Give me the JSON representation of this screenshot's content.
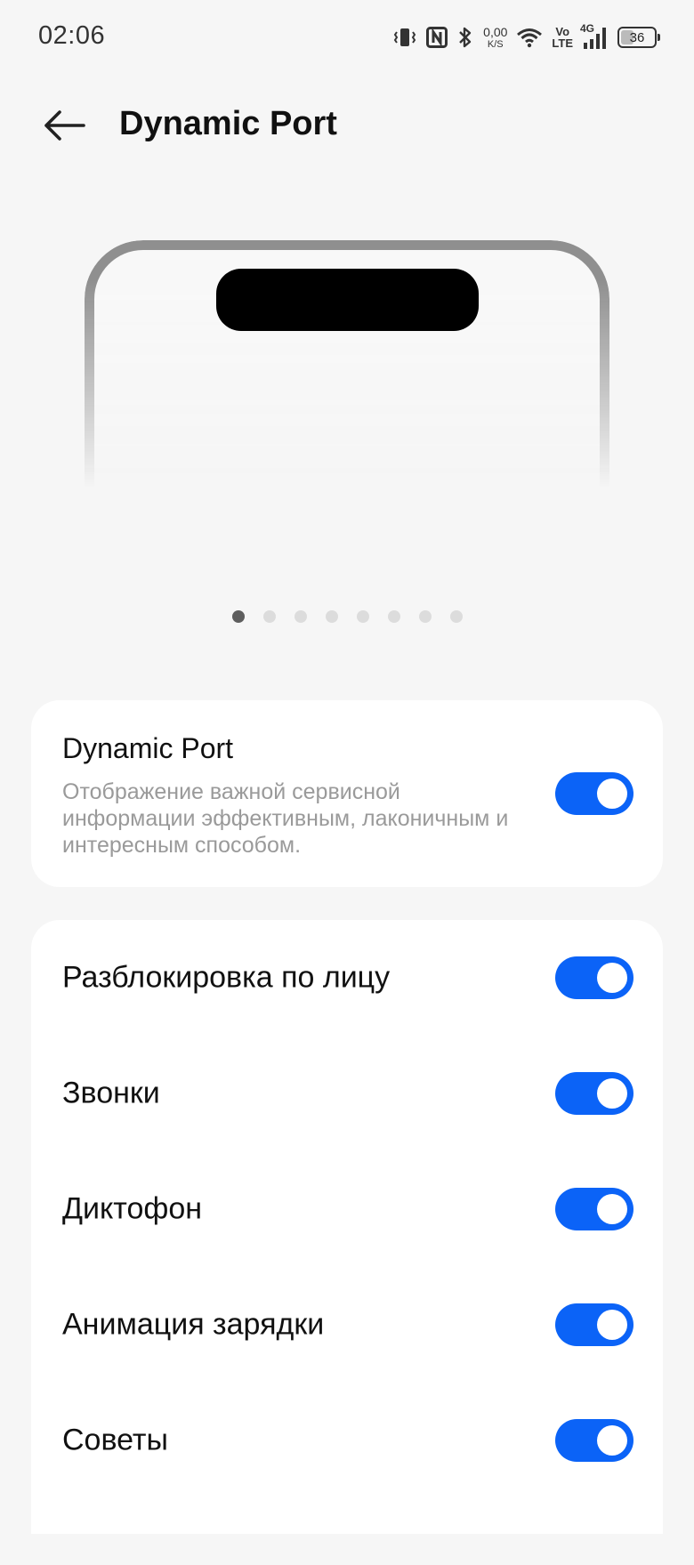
{
  "status_bar": {
    "time": "02:06",
    "net_speed_value": "0,00",
    "net_speed_unit": "K/S",
    "volte_top": "Vo",
    "volte_bottom": "LTE",
    "network_type": "4G",
    "battery_level": "36",
    "icons": [
      "vibrate-icon",
      "nfc-icon",
      "bluetooth-icon",
      "wifi-icon",
      "signal-icon",
      "battery-icon"
    ]
  },
  "header": {
    "back_icon": "arrow-left-icon",
    "title": "Dynamic Port"
  },
  "preview": {
    "page_count": 8,
    "active_page": 1
  },
  "main_card": {
    "title": "Dynamic Port",
    "description": "Отображение важной сервисной информации эффективным, лаконичным и интересным способом.",
    "enabled": true
  },
  "settings": {
    "items": [
      {
        "label": "Разблокировка по лицу",
        "enabled": true
      },
      {
        "label": "Звонки",
        "enabled": true
      },
      {
        "label": "Диктофон",
        "enabled": true
      },
      {
        "label": "Анимация зарядки",
        "enabled": true
      },
      {
        "label": "Советы",
        "enabled": true
      }
    ]
  },
  "colors": {
    "accent": "#0b63f7",
    "background": "#f6f6f6",
    "card": "#ffffff",
    "secondary_text": "#9a9a9a"
  }
}
